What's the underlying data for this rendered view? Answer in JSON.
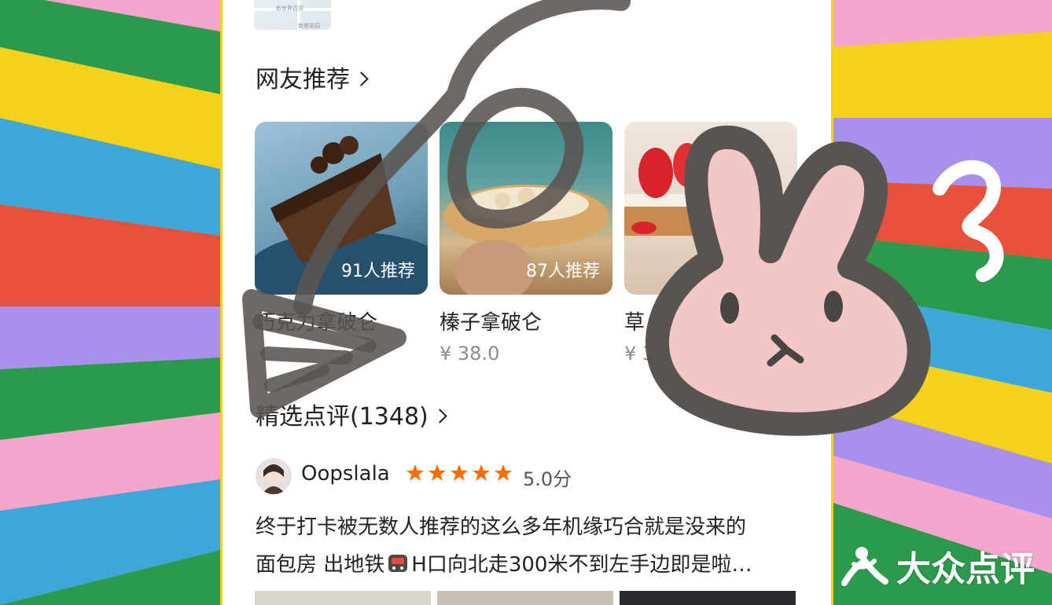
{
  "map": {
    "labels": [
      "新世界百货",
      "新景家园"
    ]
  },
  "recommend": {
    "title": "网友推荐",
    "items": [
      {
        "count": "91人推荐",
        "name": "巧克力拿破仑",
        "price": ""
      },
      {
        "count": "87人推荐",
        "name": "榛子拿破仑",
        "price": "¥ 38.0"
      },
      {
        "count": "",
        "name": "草",
        "price": "¥ 3"
      }
    ]
  },
  "reviews": {
    "title": "精选点评(1348)",
    "user": "Oopslala",
    "score": "5.0分",
    "rating": 5,
    "text_line1": "终于打卡被无数人推荐的这么多年机缘巧合就是没来的",
    "text_line2_a": "面包房 出地铁",
    "text_line2_b": "H口向北走300米不到左手边即是啦…"
  },
  "watermark": {
    "text": "大众点评"
  },
  "colors": {
    "accent_star": "#ff6b00",
    "text_primary": "#222222",
    "text_muted": "#8c8c8c"
  }
}
